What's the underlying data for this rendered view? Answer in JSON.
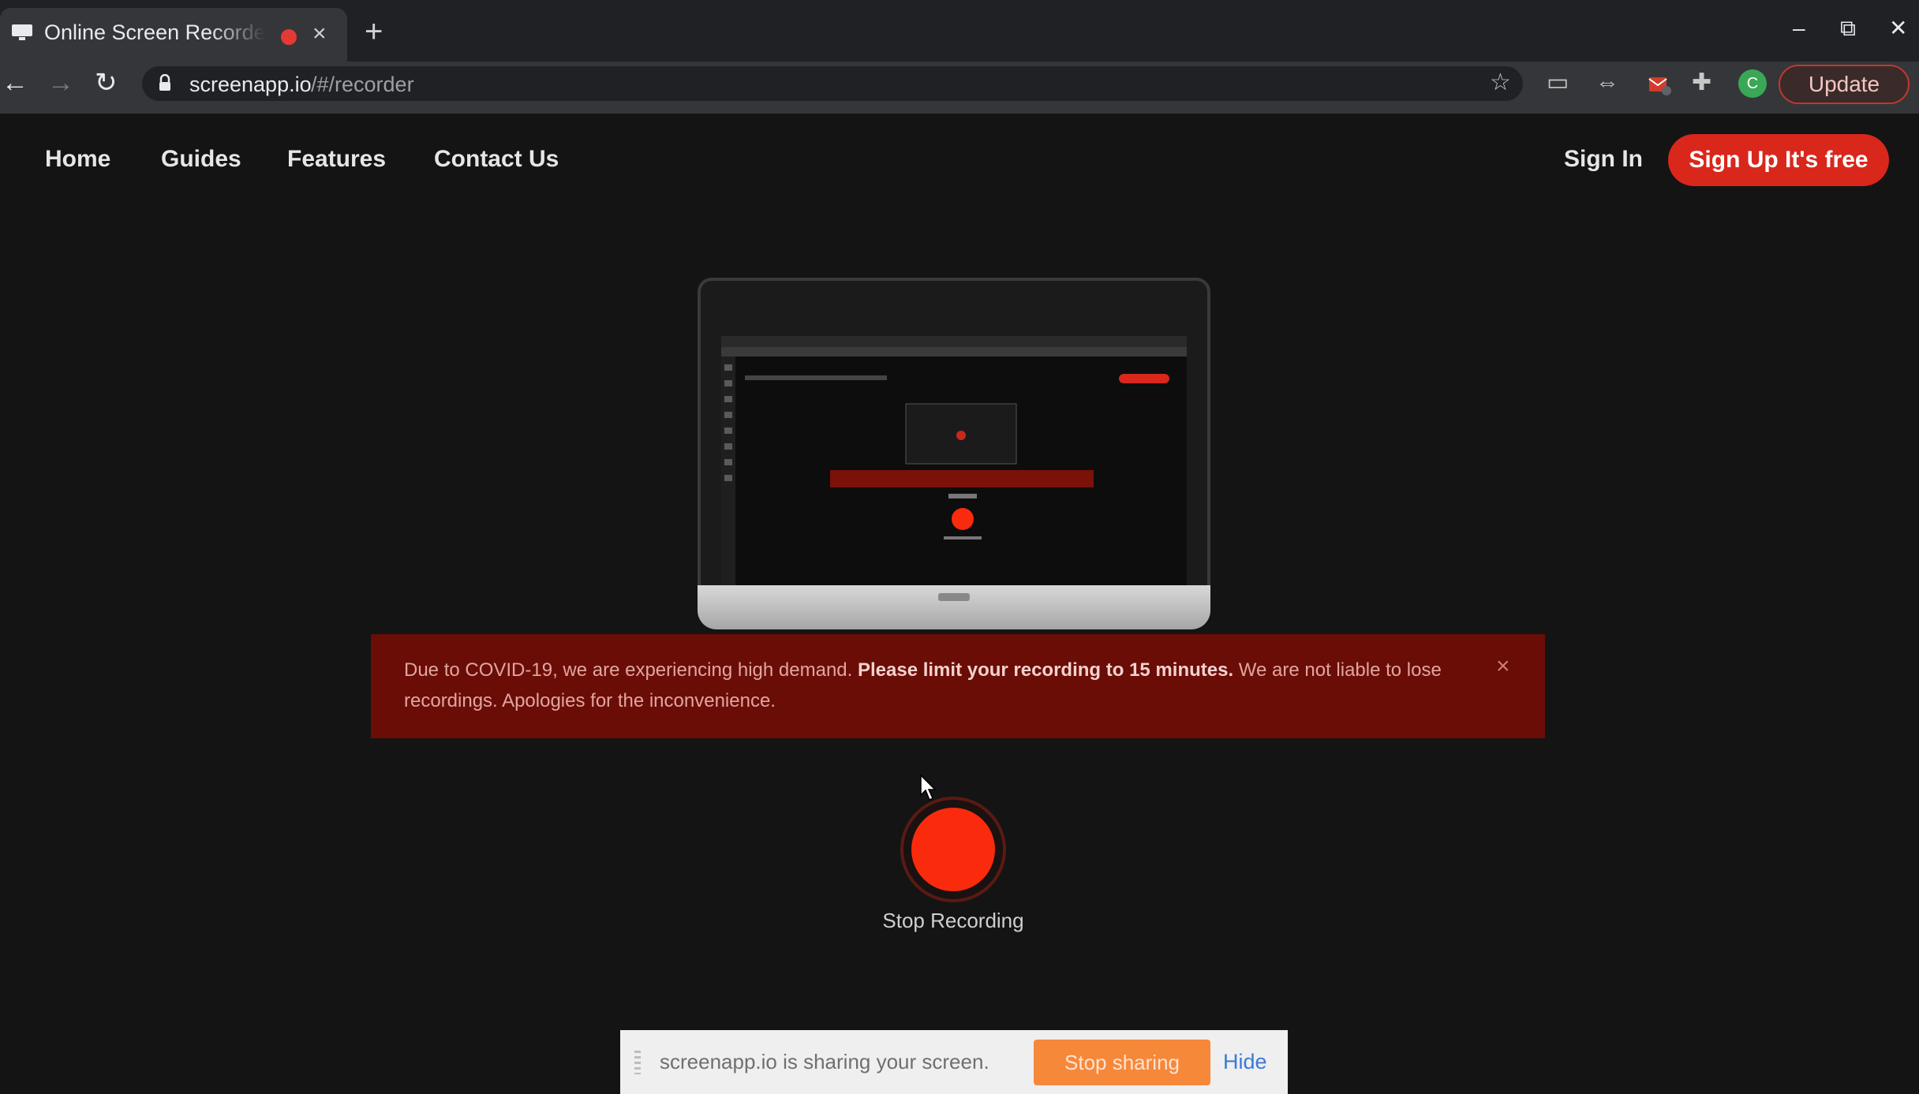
{
  "browser": {
    "tab_title": "Online Screen Recorder",
    "tab_close": "×",
    "new_tab": "+",
    "window_controls": {
      "minimize": "–",
      "restore": "⧉",
      "close": "✕"
    },
    "nav": {
      "back": "←",
      "forward": "→",
      "reload": "↻"
    },
    "url_host": "screenapp.io",
    "url_path": "/#/recorder",
    "toolbar_icons": {
      "star": "☆",
      "cast": "▭",
      "link": "⇔",
      "ext": "✚"
    },
    "profile_initial": "C",
    "update_label": "Update"
  },
  "site_nav": {
    "links": [
      "Home",
      "Guides",
      "Features",
      "Contact Us"
    ],
    "sign_in": "Sign In",
    "sign_up": "Sign Up It's free"
  },
  "alert": {
    "text_before": "Due to COVID-19, we are experiencing high demand. ",
    "text_bold": "Please limit your recording to 15 minutes.",
    "text_after": " We are not liable to lose recordings. Apologies for the inconvenience.",
    "close": "×"
  },
  "recorder": {
    "stop_label": "Stop Recording"
  },
  "share_bar": {
    "message": "screenapp.io is sharing your screen.",
    "stop_sharing": "Stop sharing",
    "hide": "Hide"
  },
  "colors": {
    "accent_red": "#d9271c",
    "record_red": "#fa2b0c",
    "alert_bg": "#6a0d07",
    "stop_sharing_orange": "#f6883a"
  }
}
